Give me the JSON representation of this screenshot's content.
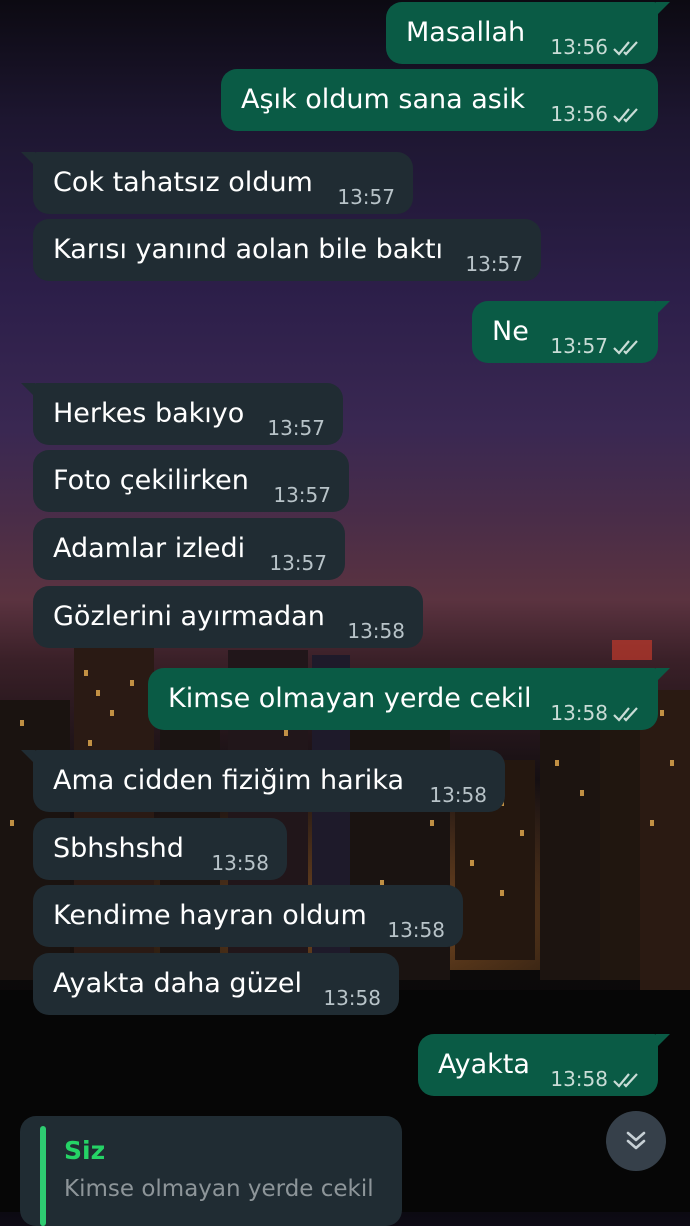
{
  "messages": [
    {
      "text": "Masallah",
      "time": "13:56",
      "direction": "out",
      "read": true
    },
    {
      "text": "Aşık oldum sana asik",
      "time": "13:56",
      "direction": "out",
      "read": true
    },
    {
      "text": "Cok tahatsız oldum",
      "time": "13:57",
      "direction": "in"
    },
    {
      "text": "Karısı yanınd aolan bile baktı",
      "time": "13:57",
      "direction": "in"
    },
    {
      "text": "Ne",
      "time": "13:57",
      "direction": "out",
      "read": true
    },
    {
      "text": "Herkes bakıyo",
      "time": "13:57",
      "direction": "in"
    },
    {
      "text": "Foto çekilirken",
      "time": "13:57",
      "direction": "in"
    },
    {
      "text": "Adamlar izledi",
      "time": "13:57",
      "direction": "in"
    },
    {
      "text": "Gözlerini ayırmadan",
      "time": "13:58",
      "direction": "in"
    },
    {
      "text": "Kimse olmayan yerde cekil",
      "time": "13:58",
      "direction": "out",
      "read": true
    },
    {
      "text": "Ama cidden fiziğim harika",
      "time": "13:58",
      "direction": "in"
    },
    {
      "text": "Sbhshshd",
      "time": "13:58",
      "direction": "in"
    },
    {
      "text": "Kendime hayran oldum",
      "time": "13:58",
      "direction": "in"
    },
    {
      "text": "Ayakta daha güzel",
      "time": "13:58",
      "direction": "in"
    },
    {
      "text": "Ayakta",
      "time": "13:58",
      "direction": "out",
      "read": true
    }
  ],
  "reply_preview": {
    "sender": "Siz",
    "text": "Kimse olmayan yerde cekil"
  },
  "icons": {
    "read_receipt": "double-check-icon",
    "scroll_down": "double-chevron-down-icon"
  },
  "colors": {
    "incoming_bubble": "#202c33",
    "outgoing_bubble": "#0a5b45",
    "reply_accent": "#25d366",
    "timestamp_incoming": "#b8c3c8",
    "timestamp_outgoing": "#c9dcd6"
  }
}
